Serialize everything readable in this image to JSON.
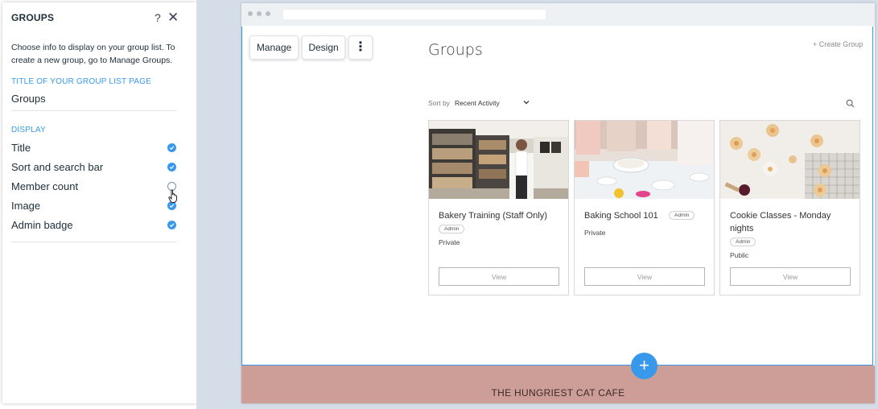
{
  "panel": {
    "title": "GROUPS",
    "help": "?",
    "close": "✕",
    "description": "Choose info to display on your group list. To create a new group, go to Manage Groups.",
    "page_title_section": "TITLE OF YOUR GROUP LIST PAGE",
    "page_title_value": "Groups",
    "display_section": "DISPLAY",
    "options": [
      {
        "label": "Title",
        "checked": true
      },
      {
        "label": "Sort and search bar",
        "checked": true
      },
      {
        "label": "Member count",
        "checked": false
      },
      {
        "label": "Image",
        "checked": true
      },
      {
        "label": "Admin badge",
        "checked": true
      }
    ]
  },
  "toolbar": {
    "manage_label": "Manage",
    "design_label": "Design",
    "more_label": "⋮"
  },
  "page": {
    "heading": "Groups",
    "create_group": "+ Create Group",
    "sort_label": "Sort by",
    "sort_value": "Recent Activity"
  },
  "cards": [
    {
      "title": "Bakery Training (Staff Only)",
      "badge": "Admin",
      "privacy": "Private",
      "view": "View"
    },
    {
      "title": "Baking School 101",
      "badge": "Admin",
      "privacy": "Private",
      "view": "View"
    },
    {
      "title": "Cookie Classes - Monday nights",
      "badge": "Admin",
      "privacy": "Public",
      "view": "View"
    }
  ],
  "footer": {
    "add_label": "+",
    "site_name": "THE HUNGRIEST CAT CAFE"
  },
  "colors": {
    "accent": "#3899ec",
    "footer_band": "#cc9e97",
    "editor_background": "#d5dde8"
  }
}
